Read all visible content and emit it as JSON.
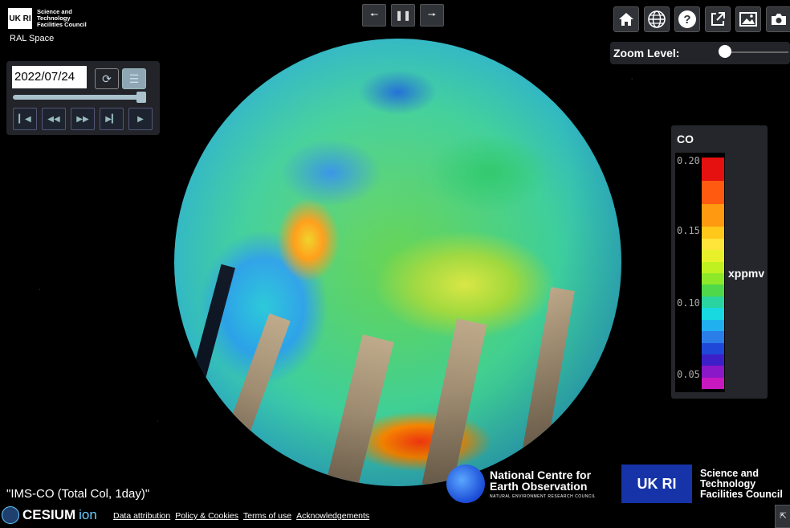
{
  "branding": {
    "ukri_logo_text": "UK RI",
    "stfc_small_lines": [
      "Science and",
      "Technology",
      "Facilities Council"
    ],
    "ral_space": "RAL Space"
  },
  "animation_controls": {
    "back_icon": "arrow-left-icon",
    "pause_icon": "pause-icon",
    "forward_icon": "arrow-right-icon"
  },
  "time_panel": {
    "date_value": "2022/07/24",
    "reset_icon": "refresh-icon",
    "menu_icon": "list-icon",
    "slider_value_fraction": 1.0,
    "playback_icons": [
      "skip-start-icon",
      "rewind-icon",
      "fast-forward-icon",
      "skip-end-icon",
      "play-icon"
    ]
  },
  "toolbar": {
    "buttons": [
      "home-icon",
      "globe-icon",
      "help-icon",
      "share-icon",
      "image-icon",
      "camera-icon"
    ]
  },
  "zoom": {
    "label": "Zoom Level:",
    "level_fraction": 0.05
  },
  "legend": {
    "title": "CO",
    "unit": "xppmv",
    "ticks": [
      "0.20",
      "0.15",
      "0.10",
      "0.05"
    ],
    "colors": [
      "#e51010",
      "#e51010",
      "#ff5a10",
      "#ff5a10",
      "#ff9a10",
      "#ff9a10",
      "#ffc81a",
      "#ffe43a",
      "#e8f02a",
      "#bff020",
      "#8ee82a",
      "#4ed84a",
      "#2ad4a0",
      "#18d8e0",
      "#20b0f0",
      "#2b7de8",
      "#2048d8",
      "#3d1fc8",
      "#8a18c8",
      "#c818c0"
    ]
  },
  "caption": "\"IMS-CO (Total Col, 1day)\"",
  "nceo": {
    "name_line1": "National Centre for",
    "name_line2": "Earth Observation",
    "subline": "NATURAL ENVIRONMENT RESEARCH COUNCIL"
  },
  "stfc_big": {
    "box_text": "UK RI",
    "lines": [
      "Science and",
      "Technology",
      "Facilities Council"
    ]
  },
  "footer": {
    "cesium": "CESIUM",
    "ion": "ion",
    "links": [
      "Data attribution",
      "Policy & Cookies",
      "Terms of use",
      "Acknowledgements"
    ]
  }
}
